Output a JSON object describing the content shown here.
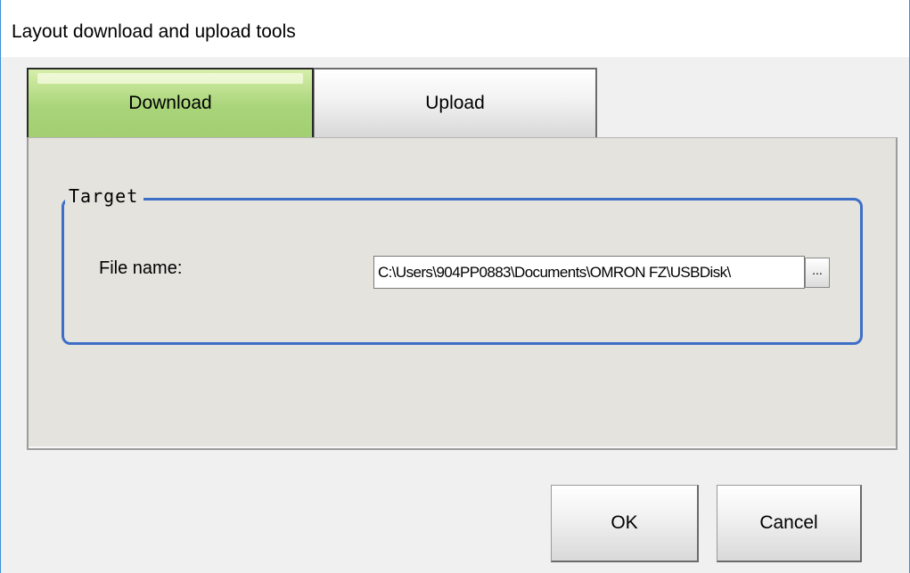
{
  "window": {
    "title": "Layout download and upload tools"
  },
  "tabs": [
    {
      "label": "Download",
      "selected": true,
      "color": "#a9d47a"
    },
    {
      "label": "Upload",
      "selected": false
    }
  ],
  "target_group": {
    "legend": "Target",
    "file_name_label": "File name:",
    "file_name_value": "C:\\Users\\904PP0883\\Documents\\OMRON FZ\\USBDisk\\",
    "browse_label": "...",
    "border_color": "#3e6fc7"
  },
  "buttons": {
    "ok_label": "OK",
    "cancel_label": "Cancel"
  }
}
